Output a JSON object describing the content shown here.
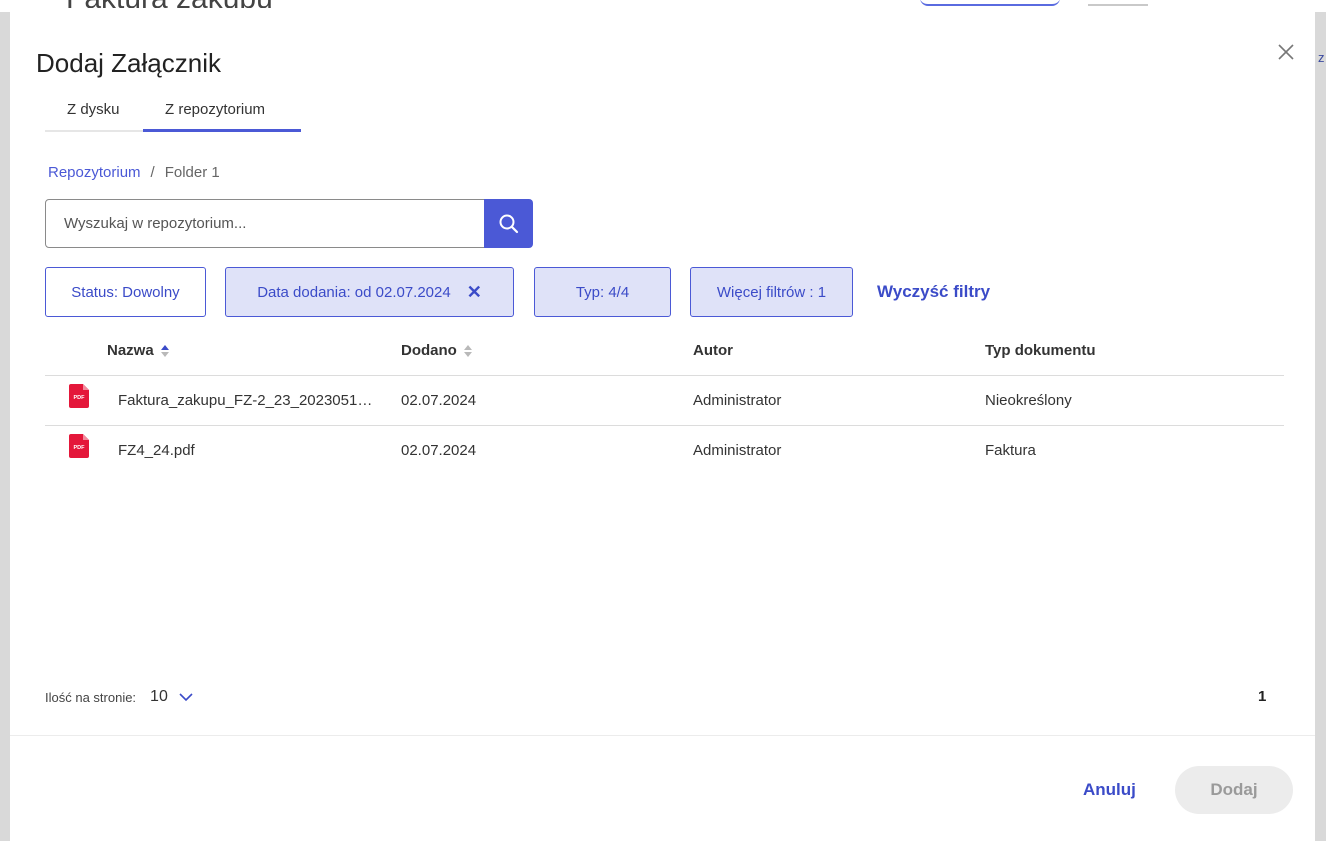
{
  "modal": {
    "title": "Dodaj Załącznik",
    "close_icon": "close-icon"
  },
  "tabs": [
    {
      "label": "Z dysku",
      "active": false
    },
    {
      "label": "Z repozytorium",
      "active": true
    }
  ],
  "breadcrumb": {
    "root": "Repozytorium",
    "separator": "/",
    "current": "Folder 1"
  },
  "search": {
    "placeholder": "Wyszukaj w repozytorium...",
    "value": "",
    "icon": "search-icon"
  },
  "filters": {
    "status": "Status: Dowolny",
    "date_added": "Data dodania: od 02.07.2024",
    "date_clear": "✕",
    "type": "Typ: 4/4",
    "more": "Więcej filtrów : 1",
    "clear_all": "Wyczyść filtry"
  },
  "table": {
    "columns": [
      "Nazwa",
      "Dodano",
      "Autor",
      "Typ dokumentu"
    ],
    "rows": [
      {
        "icon": "pdf-icon",
        "name": "Faktura_zakupu_FZ-2_23_2023051…",
        "added": "02.07.2024",
        "author": "Administrator",
        "doc_type": "Nieokreślony"
      },
      {
        "icon": "pdf-icon",
        "name": "FZ4_24.pdf",
        "added": "02.07.2024",
        "author": "Administrator",
        "doc_type": "Faktura"
      }
    ]
  },
  "pagination": {
    "page_size_label": "Ilość na stronie:",
    "page_size": "10",
    "current_page": "1"
  },
  "footer": {
    "cancel": "Anuluj",
    "add": "Dodaj"
  },
  "colors": {
    "accent": "#4b59d6",
    "filter_fill": "#dfe2f8",
    "pdf_red": "#e4173a",
    "disabled_bg": "#ececec"
  }
}
